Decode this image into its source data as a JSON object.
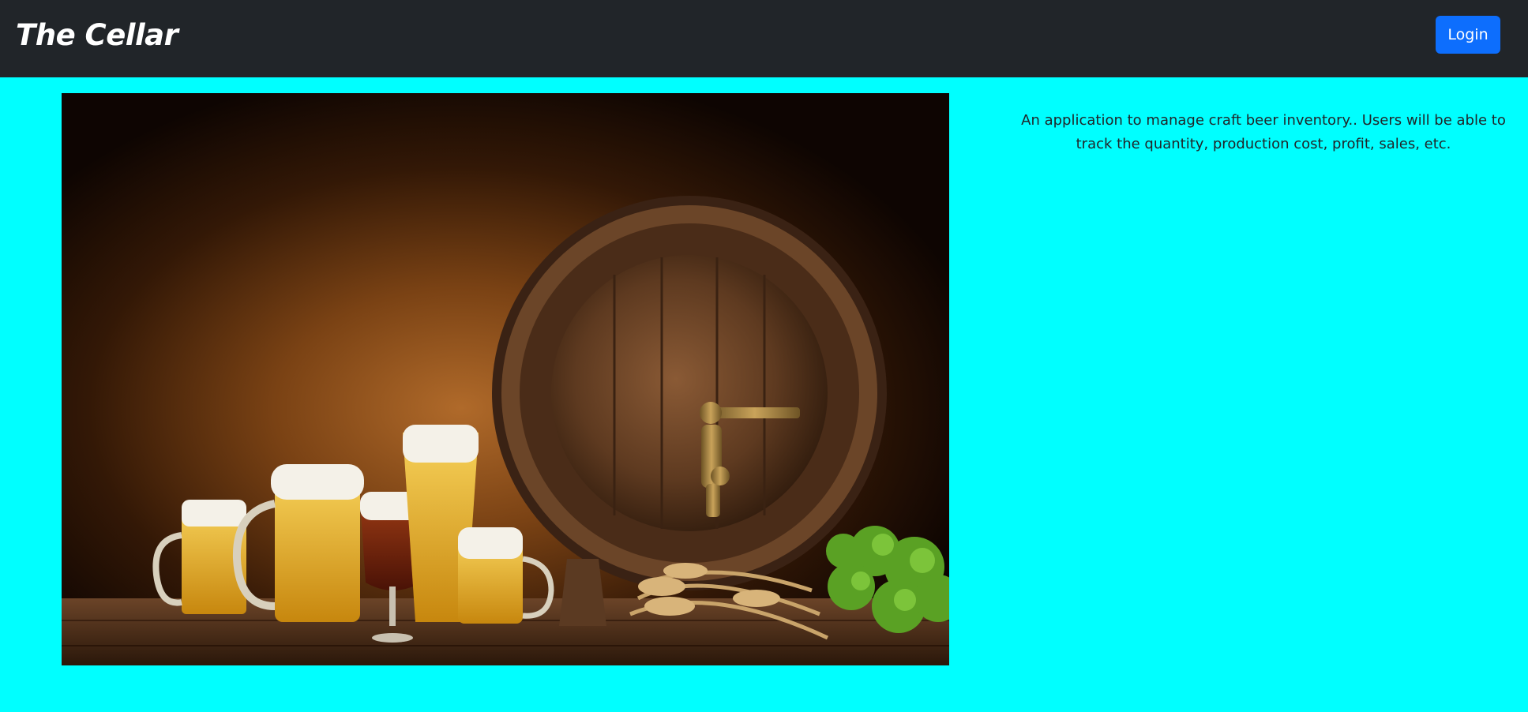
{
  "navbar": {
    "brand": "The Cellar",
    "login_label": "Login",
    "background": "#212529",
    "login_color": "#0d6efd"
  },
  "main": {
    "background": "#00ffff",
    "description": "An application to manage craft beer inventory.. Users will be able to track the quantity, production cost, profit, sales, etc."
  },
  "hero": {
    "subject": "beer-barrel-and-glasses-photo"
  }
}
